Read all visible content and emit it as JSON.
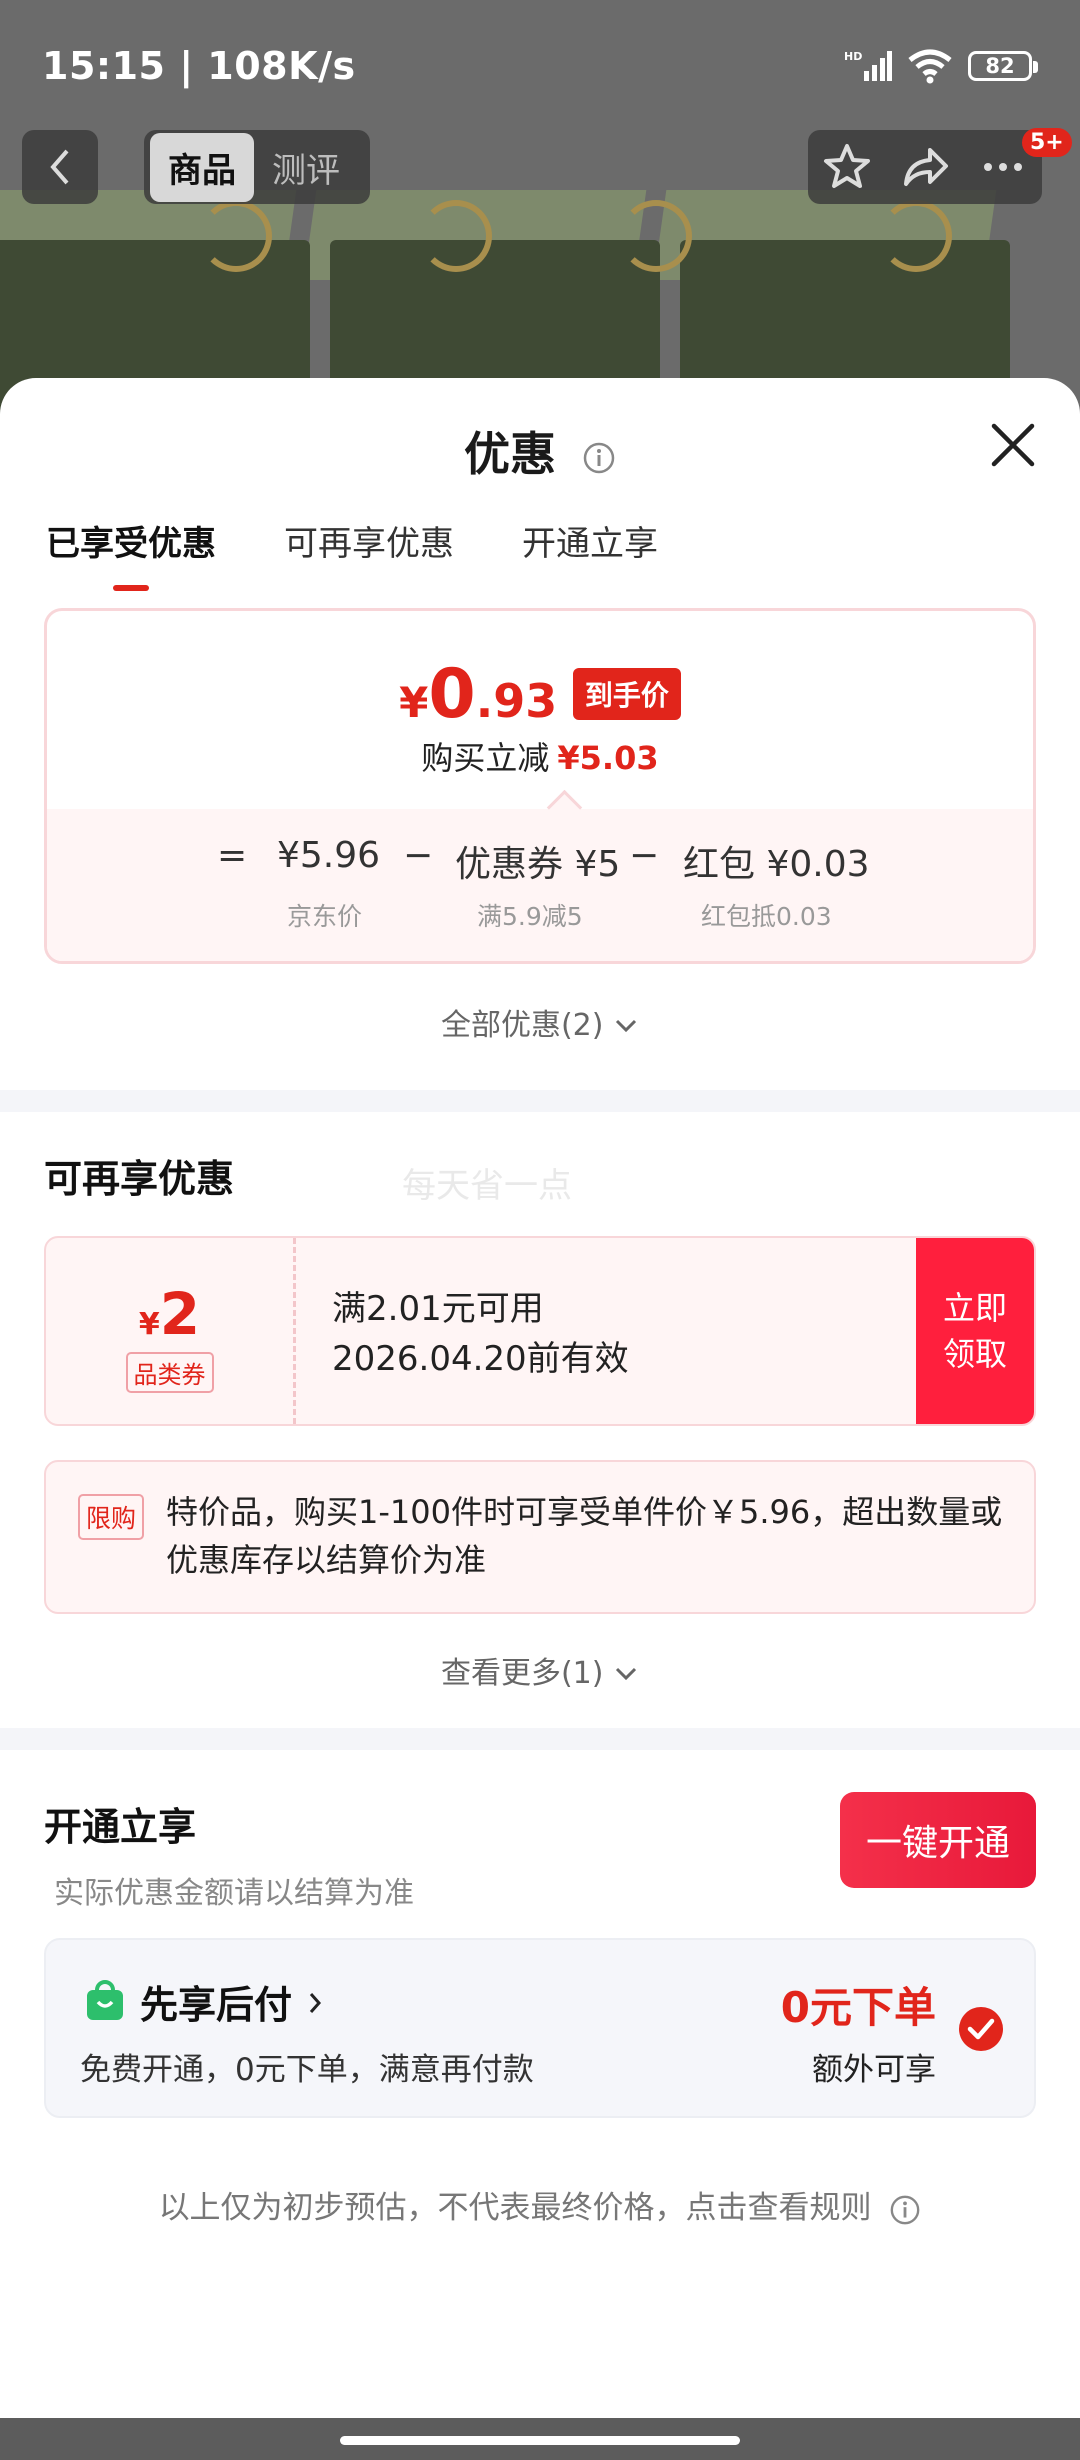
{
  "status_bar": {
    "time": "15:15 | 108K/s",
    "network": "HD",
    "battery": "82"
  },
  "top_nav": {
    "tab_product": "商品",
    "tab_review": "测评",
    "cart_badge": "5+"
  },
  "sheet": {
    "title": "优惠",
    "tabs": [
      "已享受优惠",
      "可再享优惠",
      "开通立享"
    ],
    "price": {
      "currency": "¥",
      "integer": "0",
      "decimal": ".93",
      "final_tag": "到手价",
      "saving_label": "购买立减",
      "saving_amount": "¥5.03"
    },
    "breakdown": {
      "eq": "=",
      "minus": "−",
      "jd_price": "¥5.96",
      "jd_price_label": "京东价",
      "coupon": "优惠券 ¥5",
      "coupon_label": "满5.9减5",
      "redpacket": "红包 ¥0.03",
      "redpacket_label": "红包抵0.03"
    },
    "all_discounts": "全部优惠(2)",
    "more_section": {
      "title": "可再享优惠",
      "watermark": "每天省一点",
      "coupon": {
        "currency": "¥",
        "amount": "2",
        "type": "品类券",
        "condition": "满2.01元可用",
        "expiry": "2026.04.20前有效",
        "claim_line1": "立即",
        "claim_line2": "领取"
      },
      "limit_tag": "限购",
      "limit_text": "特价品，购买1-100件时可享受单件价￥5.96，超出数量或优惠库存以结算价为准",
      "see_more": "查看更多(1)"
    },
    "open_section": {
      "title": "开通立享",
      "subtitle": "实际优惠金额请以结算为准",
      "open_button": "一键开通",
      "paylater_title": "先享后付",
      "paylater_desc": "免费开通，0元下单，满意再付款",
      "paylater_zero": "0元下单",
      "paylater_extra": "额外可享"
    },
    "disclaimer": "以上仅为初步预估，不代表最终价格，点击查看规则"
  },
  "colors": {
    "accent": "#e1251b",
    "button": "#ff1f3d",
    "paylater_icon": "#2dbf6c"
  }
}
